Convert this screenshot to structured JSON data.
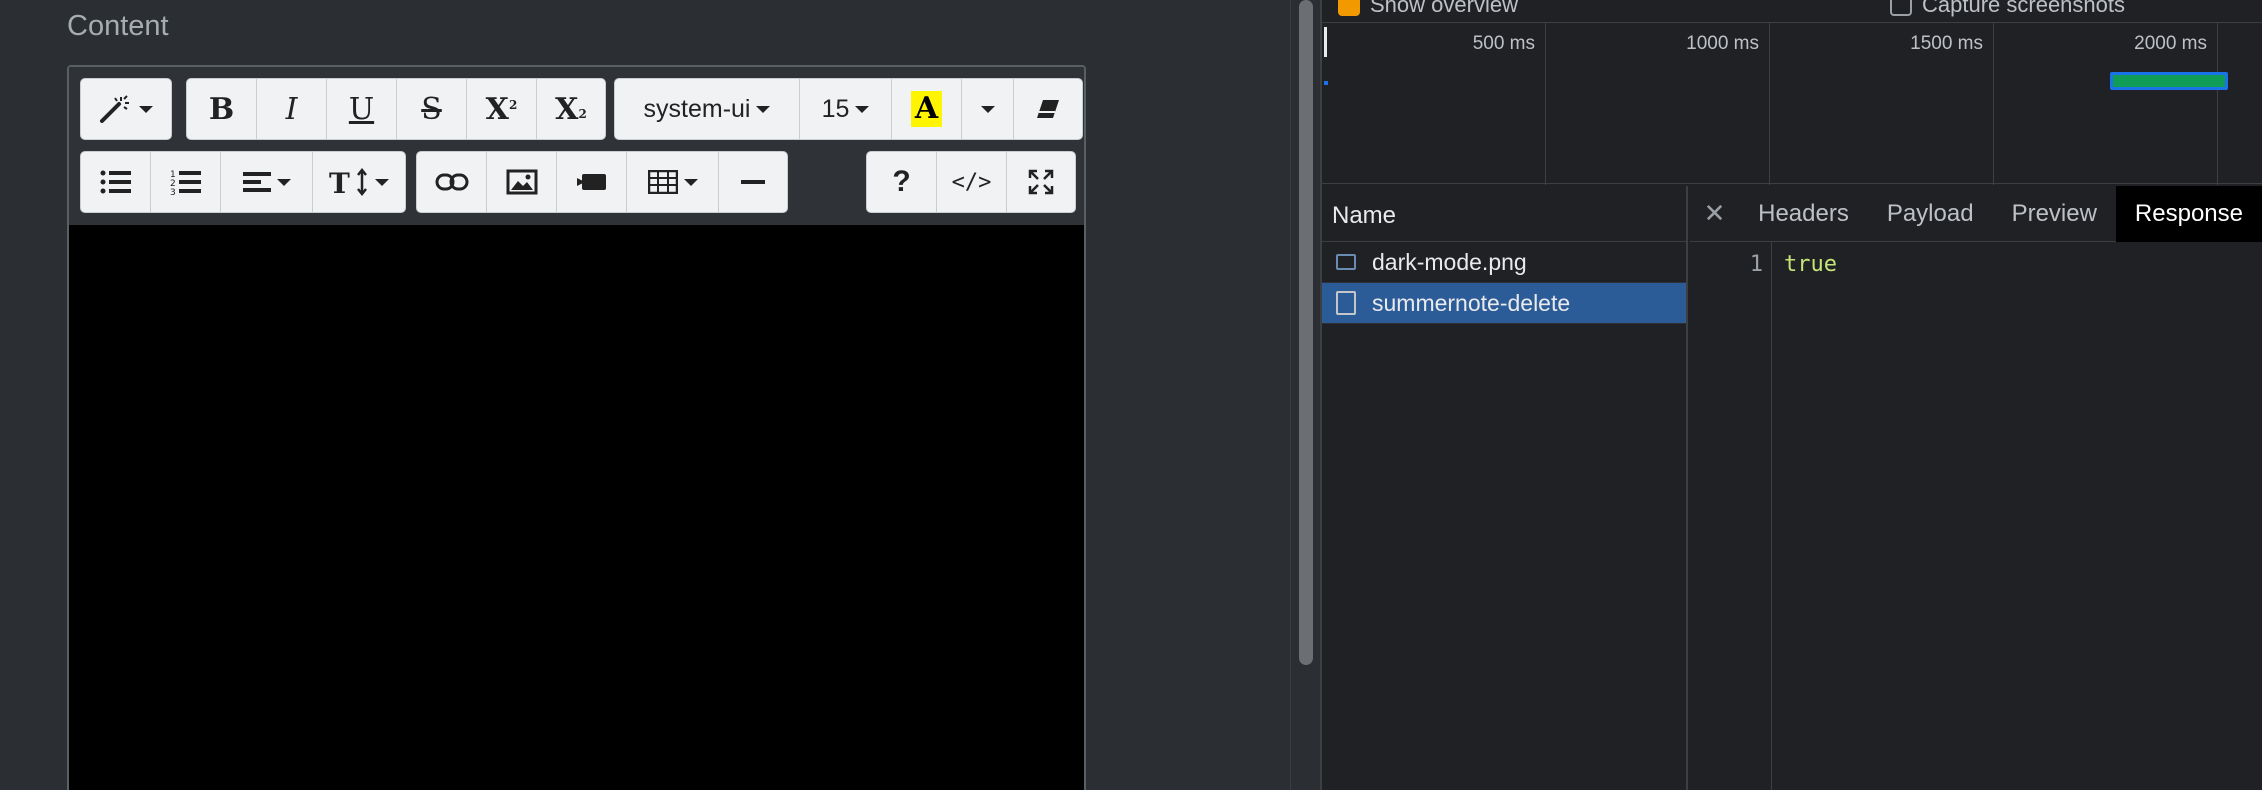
{
  "page": {
    "content_label": "Content"
  },
  "editor": {
    "toolbar": {
      "font_name": "system-ui",
      "font_size": "15",
      "highlight_letter": "A",
      "bold": "B",
      "italic": "I",
      "underline": "U",
      "strike": "S",
      "superscript": "X",
      "subscript": "X",
      "help": "?",
      "code_view": "</>"
    }
  },
  "devtools": {
    "overview": {
      "show_overview_label": "Show overview",
      "capture_screenshots_label": "Capture screenshots"
    },
    "timeline": {
      "ticks": [
        "500 ms",
        "1000 ms",
        "1500 ms",
        "2000 ms"
      ]
    },
    "requests": {
      "header": "Name",
      "items": [
        {
          "name": "dark-mode.png"
        },
        {
          "name": "summernote-delete"
        }
      ]
    },
    "detail": {
      "tabs": [
        "Headers",
        "Payload",
        "Preview",
        "Response"
      ],
      "active_tab": "Response",
      "response": {
        "line_numbers": [
          "1"
        ],
        "lines": [
          "true"
        ]
      }
    },
    "colors": {
      "accent_orange": "#f29900",
      "selected_row": "#2c5c98",
      "timeline_bar": "#0f9d58",
      "highlight_yellow": "#fff500"
    }
  }
}
